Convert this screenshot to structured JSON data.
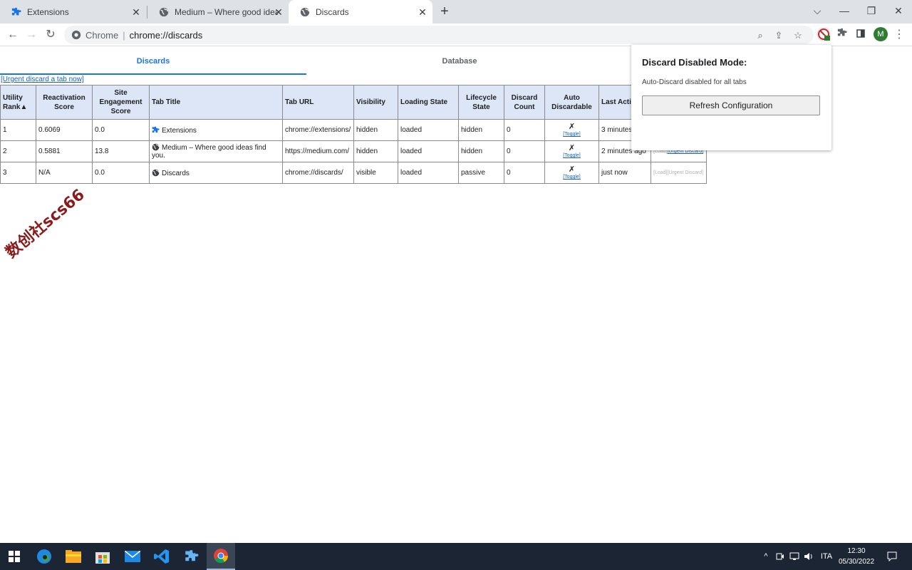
{
  "browser": {
    "tabs": [
      {
        "title": "Extensions",
        "icon": "puzzle-icon"
      },
      {
        "title": "Medium – Where good ideas find you.",
        "icon": "globe-icon"
      },
      {
        "title": "Discards",
        "icon": "globe-icon"
      }
    ],
    "omnibox": {
      "scheme": "Chrome",
      "url": "chrome://discards"
    },
    "profile_initial": "M"
  },
  "page": {
    "tabs": {
      "discards": "Discards",
      "database": "Database"
    },
    "urgent_link": "[Urgent discard a tab now]",
    "table": {
      "headers": {
        "utility_rank": "Utility Rank",
        "sort_arrow": "▲",
        "reactivation": "Reactivation Score",
        "engagement": "Site Engagement Score",
        "tab_title": "Tab Title",
        "tab_url": "Tab URL",
        "visibility": "Visibility",
        "loading": "Loading State",
        "lifecycle": "Lifecycle State",
        "discard_count": "Discard Count",
        "auto_discardable": "Auto Discardable",
        "last_active": "Last Active"
      },
      "toggle_label": "[Toggle]",
      "action_load": "[Load]",
      "action_urgent": "[Urgent Discard]",
      "rows": [
        {
          "rank": "1",
          "reactivation": "0.6069",
          "engagement": "0.0",
          "title": "Extensions",
          "url": "chrome://extensions/",
          "visibility": "hidden",
          "loading": "loaded",
          "lifecycle": "hidden",
          "discard_count": "0",
          "auto": "✗",
          "last_active": "3 minutes ago"
        },
        {
          "rank": "2",
          "reactivation": "0.5881",
          "engagement": "13.8",
          "title": "Medium – Where good ideas find you.",
          "url": "https://medium.com/",
          "visibility": "hidden",
          "loading": "loaded",
          "lifecycle": "hidden",
          "discard_count": "0",
          "auto": "✗",
          "last_active": "2 minutes ago"
        },
        {
          "rank": "3",
          "reactivation": "N/A",
          "engagement": "0.0",
          "title": "Discards",
          "url": "chrome://discards/",
          "visibility": "visible",
          "loading": "loaded",
          "lifecycle": "passive",
          "discard_count": "0",
          "auto": "✗",
          "last_active": "just now"
        }
      ]
    }
  },
  "popup": {
    "title": "Discard Disabled Mode:",
    "message": "Auto-Discard disabled for all tabs",
    "button": "Refresh Configuration"
  },
  "watermark": "数创社scs66",
  "taskbar": {
    "language": "ITA",
    "time": "12:30",
    "date": "05/30/2022"
  }
}
